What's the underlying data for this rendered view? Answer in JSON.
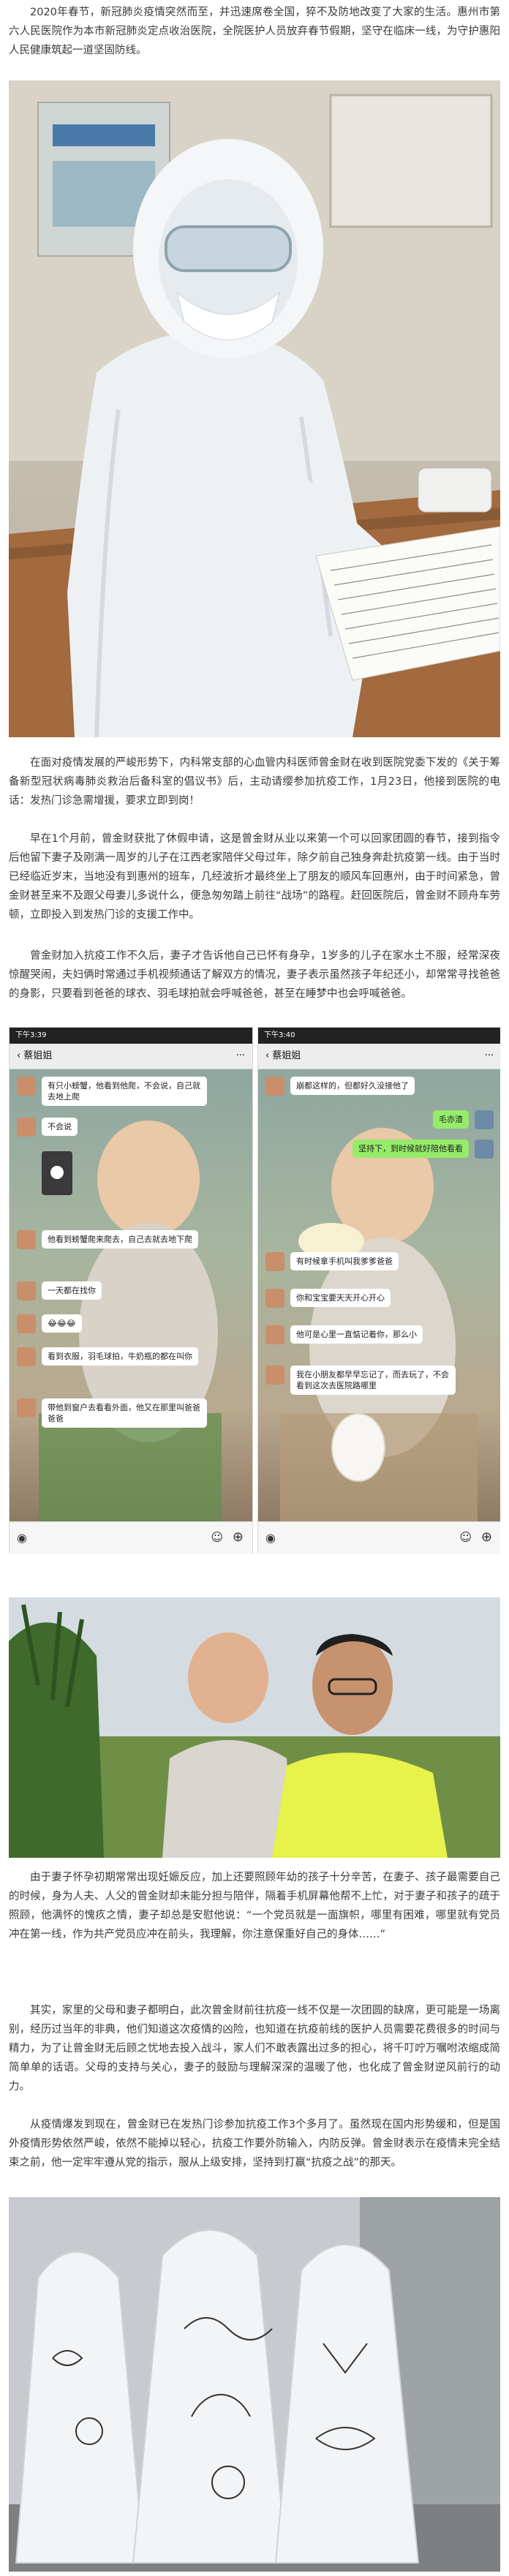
{
  "article": {
    "para1": "2020年春节，新冠肺炎疫情突然而至，并迅速席卷全国，猝不及防地改变了大家的生活。惠州市第六人民医院作为本市新冠肺炎定点收治医院，全院医护人员放弃春节假期，坚守在临床一线，为守护惠阳人民健康筑起一道坚固防线。",
    "para2": "在面对疫情发展的严峻形势下，内科常支部的心血管内科医师曾金财在收到医院党委下发的《关于筹备新型冠状病毒肺炎救治后备科室的倡议书》后，主动请缨参加抗疫工作，1月23日，他接到医院的电话：发热门诊急需增援，要求立即到岗！",
    "para3": "早在1个月前，曾金财获批了休假申请，这是曾金财从业以来第一个可以回家团圆的春节，接到指令后他留下妻子及刚满一周岁的儿子在江西老家陪伴父母过年，除夕前自己独身奔赴抗疫第一线。由于当时已经临近岁末，当地没有到惠州的班车，几经波折才最终坐上了朋友的顺风车回惠州，由于时间紧急，曾金财甚至来不及跟父母妻儿多说什么，便急匆匆踏上前往“战场”的路程。赶回医院后，曾金财不顾舟车劳顿，立即投入到发热门诊的支援工作中。",
    "para4": "曾金财加入抗疫工作不久后，妻子才告诉他自己已怀有身孕，1岁多的儿子在家水土不服，经常深夜惊醒哭闹，夫妇俩时常通过手机视频通话了解双方的情况，妻子表示虽然孩子年纪还小，却常常寻找爸爸的身影，只要看到爸爸的球衣、羽毛球拍就会呼喊爸爸，甚至在睡梦中也会呼喊爸爸。",
    "para5": "由于妻子怀孕初期常常出现妊娠反应，加上还要照顾年幼的孩子十分辛苦，在妻子、孩子最需要自己的时候，身为人夫、人父的曾金财却未能分担与陪伴，隔着手机屏幕他帮不上忙，对于妻子和孩子的疏于照顾，他满怀的愧疚之情，妻子却总是安慰他说：“一个党员就是一面旗帜，哪里有困难，哪里就有党员冲在第一线，作为共产党员应冲在前头，我理解，你注意保重好自己的身体……”",
    "para6": "其实，家里的父母和妻子都明白，此次曾金财前往抗疫一线不仅是一次团圆的缺席，更可能是一场离别，经历过当年的非典，他们知道这次疫情的凶险，也知道在抗疫前线的医护人员需要花费很多的时间与精力，为了让曾金财无后顾之忧地去投入战斗，家人们不敢表露出过多的担心，将千叮咛万嘱咐浓缩成简简单单的话语。父母的支持与关心，妻子的鼓励与理解深深的温暖了他，也化成了曾金财逆风前行的动力。",
    "para7": "从疫情爆发到现在，曾金财已在发热门诊参加抗疫工作3个多月了。虽然现在国内形势缓和，但是国外疫情形势依然严峻，依然不能掉以轻心，抗疫工作要外防输入，内防反弹。曾金财表示在疫情未完全结束之前，他一定牢牢遵从党的指示，服从上级安排，坚持到打赢“抗疫之战”的那天。"
  },
  "chat_left": {
    "time": "下午3:39",
    "contact": "蔡姐姐",
    "messages": [
      {
        "side": "left",
        "text": "有只小螃蟹，他看到他爬，不会说，自己就去地上爬"
      },
      {
        "side": "left",
        "text": "不会说"
      },
      {
        "side": "left",
        "text": "他看到螃蟹爬来爬去，自己去就去地下爬"
      },
      {
        "side": "left",
        "text": "一天都在找你"
      },
      {
        "side": "left",
        "text": "😂😂😂"
      },
      {
        "side": "left",
        "text": "看到衣服，羽毛球拍，牛奶瓶的都在叫你"
      },
      {
        "side": "left",
        "text": "带他到窗户去看看外面，他又在那里叫爸爸爸爸"
      }
    ]
  },
  "chat_right": {
    "time": "下午3:40",
    "contact": "蔡姐姐",
    "messages": [
      {
        "side": "left",
        "text": "崩都这样的，但都好久没接他了"
      },
      {
        "side": "right",
        "text": "毛亦渣"
      },
      {
        "side": "right",
        "text": "坚持下，到时候就好陪他看看"
      },
      {
        "side": "left",
        "text": "有时候拿手机叫我爹爹爸爸"
      },
      {
        "side": "left",
        "text": "你和宝宝要天天开心开心"
      },
      {
        "side": "left",
        "text": "他可是心里一直惦记着你，那么小"
      },
      {
        "side": "left",
        "text": "我在小朋友都早早忘记了，而去玩了，不会看到这次去医院路哪里"
      }
    ]
  },
  "colors": {
    "bubble_mine": "#95ec69",
    "bubble_other": "#ffffff"
  },
  "icons": [
    "back-arrow-icon",
    "more-icon",
    "voice-icon",
    "emoji-icon",
    "plus-icon"
  ]
}
